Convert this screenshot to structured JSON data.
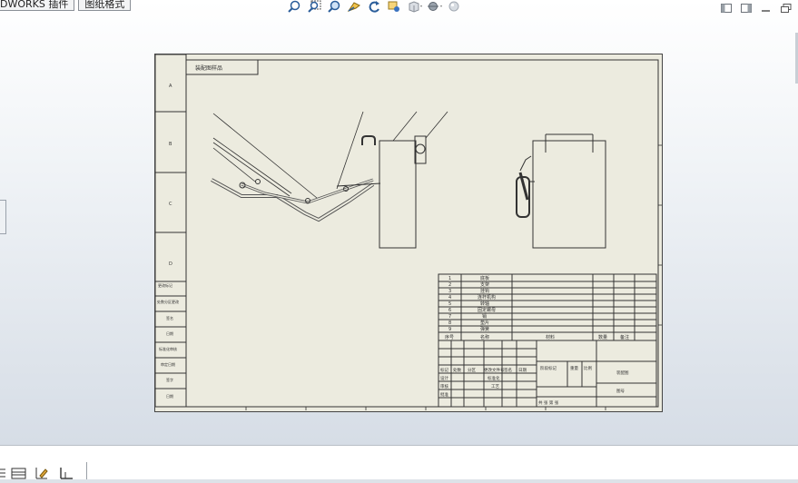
{
  "window": {
    "tabs": [
      {
        "label": "DWORKS 插件"
      },
      {
        "label": "图纸格式"
      }
    ],
    "toolbar_icons": [
      "zoom-fit-icon",
      "zoom-area-icon",
      "zoom-in-out-icon",
      "pan-icon",
      "rotate-icon",
      "previous-view-icon",
      "view-orientation-icon",
      "display-style-icon",
      "appearance-icon"
    ],
    "window_controls": [
      "tile-left-icon",
      "tile-right-icon",
      "minimize-icon",
      "restore-icon"
    ]
  },
  "drawing": {
    "header_text": "装配图样品",
    "border_letters": [
      "A",
      "B",
      "C",
      "D"
    ],
    "side_labels": [
      "更改标记",
      "处数分区更改",
      "签名",
      "日期",
      "标准化审核",
      "审定日期",
      "签字",
      "日期"
    ],
    "bom": {
      "rows": [
        {
          "no": "1",
          "name": "底板"
        },
        {
          "no": "2",
          "name": "支架"
        },
        {
          "no": "3",
          "name": "挂钩"
        },
        {
          "no": "4",
          "name": "连杆机构"
        },
        {
          "no": "5",
          "name": "转轴"
        },
        {
          "no": "6",
          "name": "固定螺母"
        },
        {
          "no": "7",
          "name": "销"
        },
        {
          "no": "8",
          "name": "垫片"
        },
        {
          "no": "9",
          "name": "弹簧"
        }
      ],
      "header": {
        "col1": "序号",
        "col2": "名称",
        "col3": "材料",
        "col4": "数量",
        "col5": "备注"
      }
    },
    "title_block": {
      "labels": [
        "标记",
        "处数",
        "分区",
        "更改文件号",
        "签名",
        "日期",
        "设计",
        "标准化",
        "审核",
        "工艺",
        "批准"
      ],
      "stage_labels": [
        "阶段标记",
        "重量",
        "比例"
      ],
      "sheet_info": "共 张 第 张",
      "drawing_name": "装配图",
      "drawing_number": "图号"
    }
  },
  "status_bar": {
    "icons": [
      "layers-icon",
      "grid-icon",
      "sketch-icon",
      "snap-icon"
    ]
  }
}
